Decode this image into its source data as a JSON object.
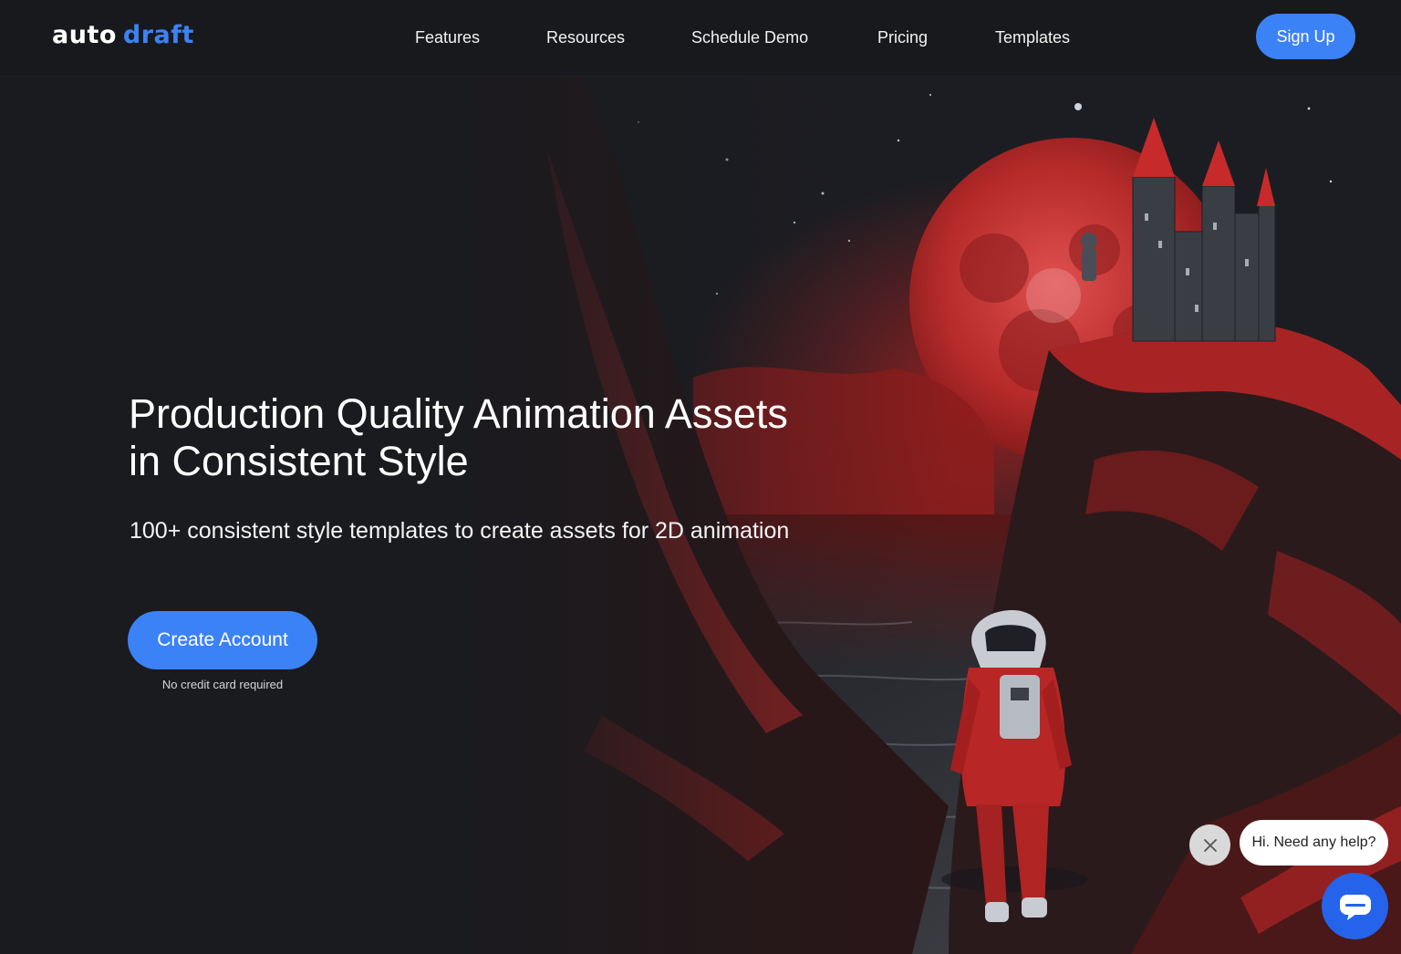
{
  "brand": {
    "logo_part1": "auto",
    "logo_part2": "draft",
    "accent": "#3b82f6"
  },
  "nav": {
    "links": [
      "Features",
      "Resources",
      "Schedule Demo",
      "Pricing",
      "Templates"
    ],
    "signup_label": "Sign Up"
  },
  "hero": {
    "title_line1": "Production Quality Animation Assets",
    "title_line2": "in Consistent Style",
    "subtitle": "100+ consistent style templates to create assets for 2D animation",
    "cta_label": "Create Account",
    "cta_note": "No credit card required",
    "artwork": "astronaut walking toward castle on cliff under red moon"
  },
  "chat": {
    "bubble_text": "Hi. Need any help?",
    "close_icon": "close-icon",
    "launcher_icon": "chat-icon"
  }
}
